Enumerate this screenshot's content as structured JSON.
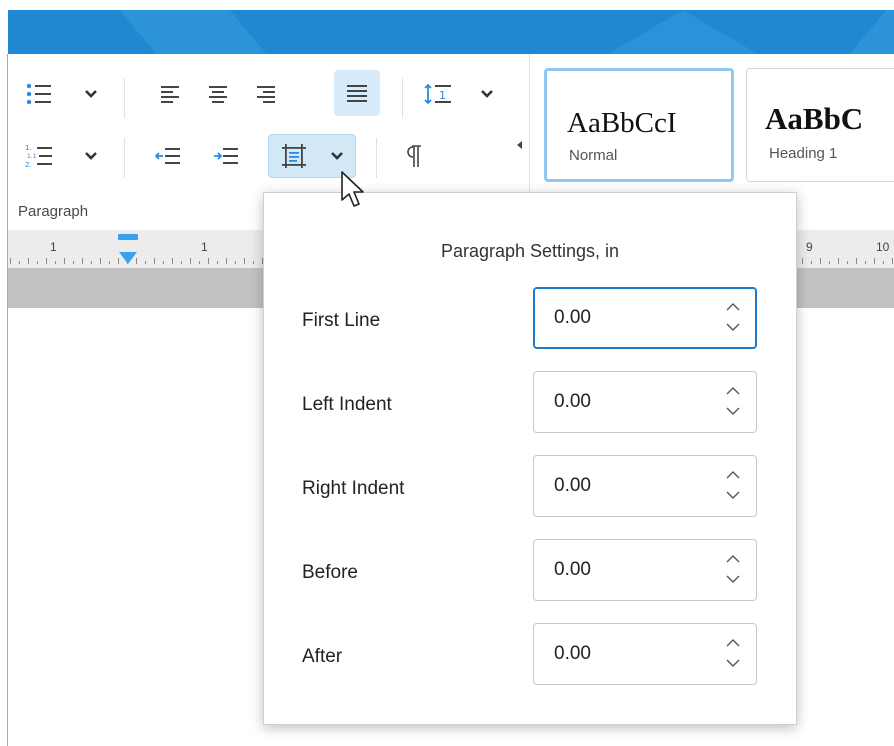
{
  "ribbon": {
    "group_label": "Paragraph",
    "buttons": [
      {
        "name": "bullet-list-button",
        "icon": "bullet-list-icon"
      },
      {
        "name": "bullet-list-dropdown",
        "icon": "chevron-down-icon"
      },
      {
        "name": "align-left-button",
        "icon": "align-left-icon"
      },
      {
        "name": "align-center-button",
        "icon": "align-center-icon"
      },
      {
        "name": "align-right-button",
        "icon": "align-right-icon"
      },
      {
        "name": "justify-button",
        "icon": "justify-icon",
        "active": true
      },
      {
        "name": "line-spacing-button",
        "icon": "line-spacing-icon"
      },
      {
        "name": "line-spacing-dropdown",
        "icon": "chevron-down-icon"
      },
      {
        "name": "numbered-list-button",
        "icon": "numbered-list-icon"
      },
      {
        "name": "numbered-list-dropdown",
        "icon": "chevron-down-icon"
      },
      {
        "name": "decrease-indent-button",
        "icon": "decrease-indent-icon"
      },
      {
        "name": "increase-indent-button",
        "icon": "increase-indent-icon"
      },
      {
        "name": "paragraph-settings-button",
        "icon": "paragraph-settings-icon",
        "pressed": true
      },
      {
        "name": "show-formatting-button",
        "icon": "pilcrow-icon"
      }
    ]
  },
  "styles": [
    {
      "sample": "AaBbCcI",
      "caption": "Normal",
      "selected": true
    },
    {
      "sample": "AaBbC",
      "caption": "Heading 1",
      "selected": false
    }
  ],
  "ruler": {
    "labels": [
      "1",
      "1",
      "9",
      "10"
    ]
  },
  "popover": {
    "title": "Paragraph Settings, in",
    "fields": [
      {
        "label": "First Line",
        "value": "0.00",
        "focused": true
      },
      {
        "label": "Left Indent",
        "value": "0.00"
      },
      {
        "label": "Right Indent",
        "value": "0.00"
      },
      {
        "label": "Before",
        "value": "0.00"
      },
      {
        "label": "After",
        "value": "0.00"
      }
    ]
  },
  "colors": {
    "titlebar": "#1e88d0",
    "accent": "#1b79c8",
    "active_button": "#d7ebfa",
    "ruler_marker": "#3aa0ea"
  }
}
